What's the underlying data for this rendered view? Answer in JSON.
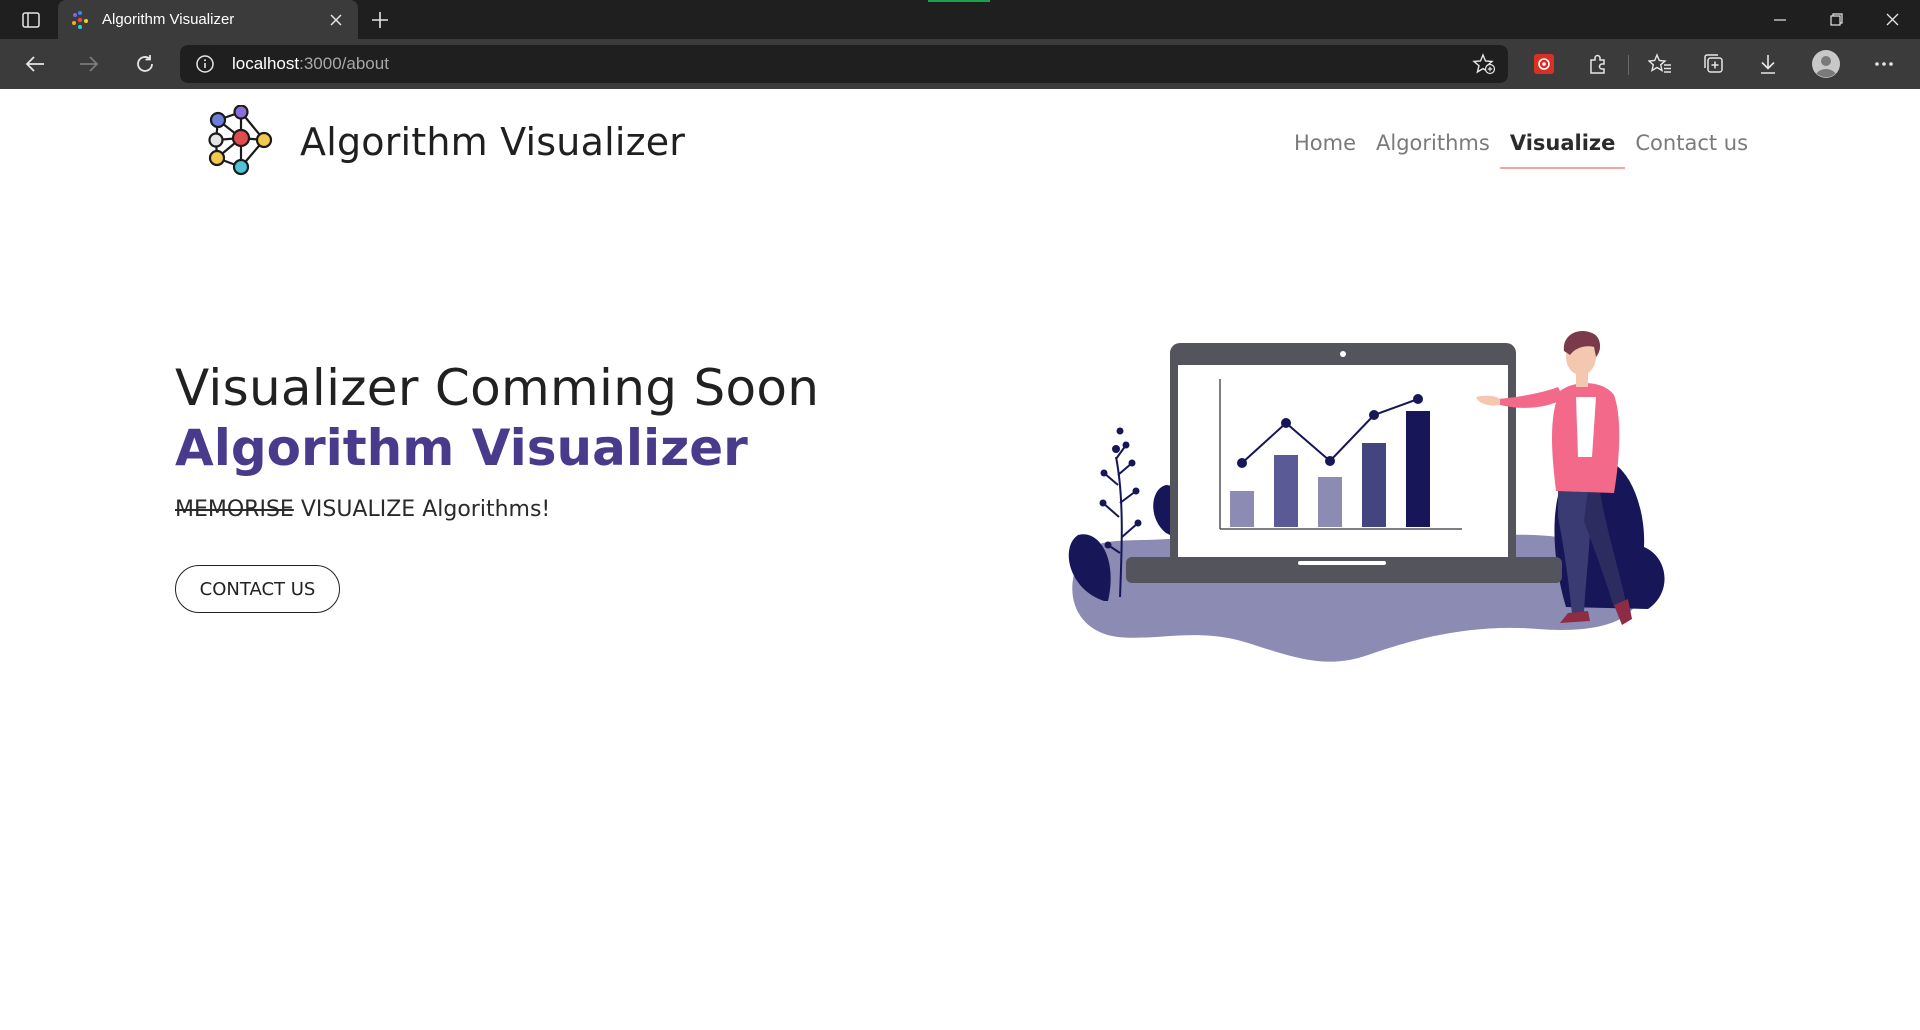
{
  "browser": {
    "tab_title": "Algorithm Visualizer",
    "url_host": "localhost",
    "url_path": ":3000/about"
  },
  "header": {
    "brand_name": "Algorithm Visualizer",
    "nav": [
      {
        "label": "Home",
        "active": false
      },
      {
        "label": "Algorithms",
        "active": false
      },
      {
        "label": "Visualize",
        "active": true
      },
      {
        "label": "Contact us",
        "active": false
      }
    ]
  },
  "hero": {
    "title": "Visualizer Comming Soon",
    "subtitle": "Algorithm Visualizer",
    "tagline_struck": "MEMORISE",
    "tagline_rest": "VISUALIZE Algorithms!",
    "cta_label": "CONTACT US"
  },
  "colors": {
    "accent_purple": "#4a3a8c",
    "active_underline": "#f3a3a0",
    "illustration_navy": "#1a1a5e"
  }
}
